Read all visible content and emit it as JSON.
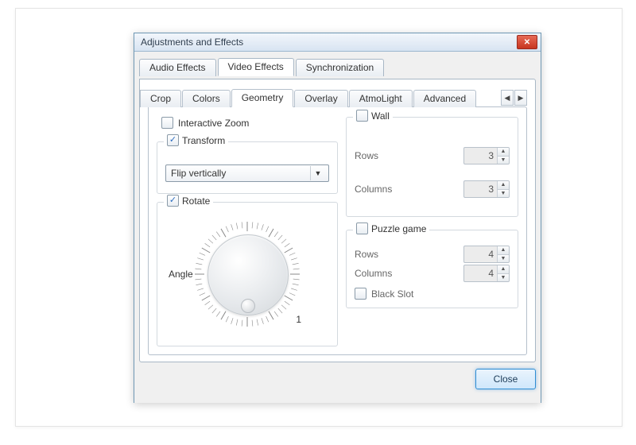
{
  "window": {
    "title": "Adjustments and Effects"
  },
  "tabs": {
    "audio": "Audio Effects",
    "video": "Video Effects",
    "sync": "Synchronization"
  },
  "subtabs": {
    "crop": "Crop",
    "colors": "Colors",
    "geometry": "Geometry",
    "overlay": "Overlay",
    "atmolight": "AtmoLight",
    "advanced": "Advanced"
  },
  "geometry": {
    "interactive_zoom": {
      "label": "Interactive Zoom",
      "checked": false
    },
    "transform": {
      "label": "Transform",
      "checked": true,
      "value": "Flip vertically"
    },
    "rotate": {
      "label": "Rotate",
      "checked": true,
      "angle_label": "Angle",
      "scale_mark": "1"
    },
    "wall": {
      "label": "Wall",
      "checked": false,
      "rows_label": "Rows",
      "rows": 3,
      "cols_label": "Columns",
      "cols": 3
    },
    "puzzle": {
      "label": "Puzzle game",
      "checked": false,
      "rows_label": "Rows",
      "rows": 4,
      "cols_label": "Columns",
      "cols": 4,
      "blackslot_label": "Black Slot",
      "blackslot": false
    }
  },
  "buttons": {
    "close": "Close"
  }
}
